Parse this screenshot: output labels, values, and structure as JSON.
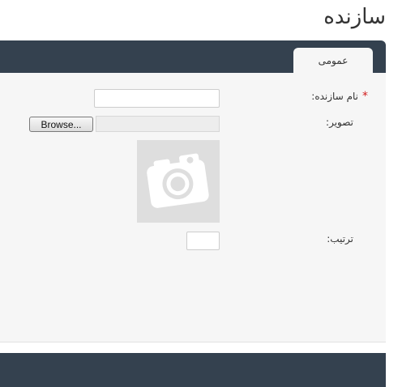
{
  "page": {
    "title": "سازنده"
  },
  "tabs": [
    {
      "label": "عمومی"
    }
  ],
  "form": {
    "name": {
      "label": "نام سازنده:",
      "required_mark": "*",
      "value": ""
    },
    "image": {
      "label": "تصویر:",
      "browse_label": "Browse...",
      "file_value": "",
      "placeholder_icon": "camera-icon"
    },
    "order": {
      "label": "ترتیب:",
      "value": ""
    }
  },
  "colors": {
    "header_bar": "#34414f",
    "panel": "#f6f6f6",
    "required": "#d21d1d"
  }
}
